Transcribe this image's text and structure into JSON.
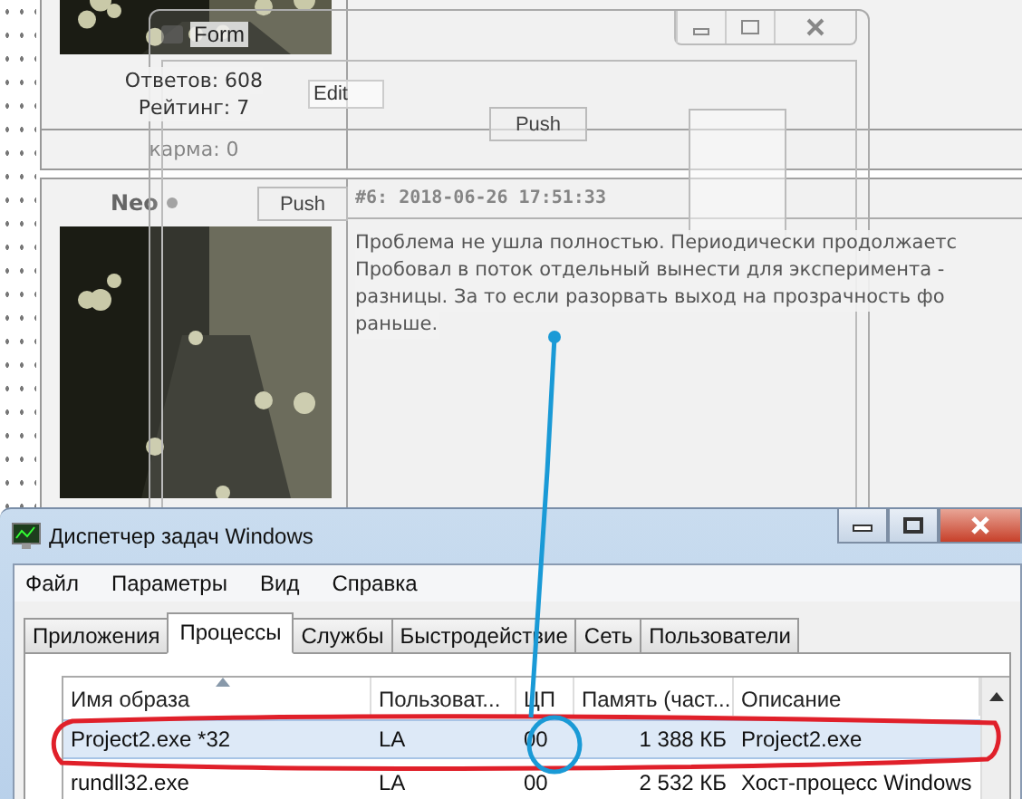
{
  "forum": {
    "posts": [
      {
        "picture": {
          "kind": "picture"
        },
        "stats": [
          "Ответов: 608",
          "Рейтинг: 7"
        ],
        "karma": "карма: 0"
      },
      {
        "picture": {
          "kind": "picture"
        },
        "author": "Neo",
        "date": "#6: 2018-06-26 17:51:33",
        "lines": [
          "Проблема не ушла полностью. Периодически продолжаетс",
          "Пробовал в поток отдельный вынести для эксперимента -",
          "разницы. За то если разорвать выход на прозрачность фо",
          "раньше."
        ]
      }
    ]
  },
  "form_window": {
    "title": "Form",
    "edit": {
      "value": "Edit"
    },
    "buttons": [
      "Push",
      "Push"
    ]
  },
  "task_manager": {
    "title": "Диспетчер задач Windows",
    "menu": [
      "Файл",
      "Параметры",
      "Вид",
      "Справка"
    ],
    "tabs": [
      {
        "label": "Приложения",
        "selected": false
      },
      {
        "label": "Процессы",
        "selected": true
      },
      {
        "label": "Службы",
        "selected": false
      },
      {
        "label": "Быстродействие",
        "selected": false
      },
      {
        "label": "Сеть",
        "selected": false
      },
      {
        "label": "Пользователи",
        "selected": false
      }
    ],
    "table": {
      "columns": [
        "Имя образа",
        "Пользоват...",
        "ЦП",
        "Память (част...",
        "Описание"
      ],
      "rows": [
        {
          "cells": [
            "Project2.exe *32",
            "LA",
            "00",
            "1 388 КБ",
            "Project2.exe"
          ],
          "selected": true
        },
        {
          "cells": [
            "rundll32.exe",
            "LA",
            "00",
            "2 532 КБ",
            "Хост-процесс Windows"
          ],
          "selected": false
        }
      ]
    }
  },
  "annotations": [
    {
      "kind": "ellipse",
      "color": "#e0202a"
    },
    {
      "kind": "pointer",
      "color": "#1a9ad6"
    }
  ]
}
